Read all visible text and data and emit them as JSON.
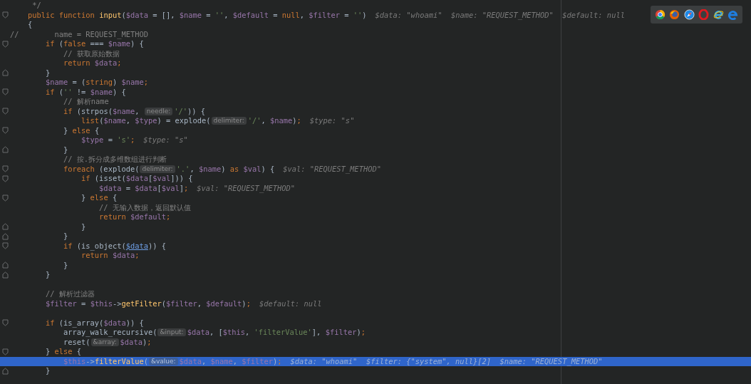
{
  "editor": {
    "lines": [
      {
        "current": false,
        "kind": "plain",
        "tokens": [
          {
            "kind": "comment",
            "text": "     */"
          }
        ]
      },
      {
        "current": false,
        "kind": "opener",
        "tokens": [
          {
            "kind": "kw",
            "text": "    public function "
          },
          {
            "kind": "fn",
            "text": "input"
          },
          {
            "kind": "plain",
            "text": "("
          },
          {
            "kind": "var",
            "text": "$data"
          },
          {
            "kind": "plain",
            "text": " = [], "
          },
          {
            "kind": "var",
            "text": "$name"
          },
          {
            "kind": "plain",
            "text": " = "
          },
          {
            "kind": "str",
            "text": "''"
          },
          {
            "kind": "plain",
            "text": ", "
          },
          {
            "kind": "var",
            "text": "$default"
          },
          {
            "kind": "plain",
            "text": " = "
          },
          {
            "kind": "kw",
            "text": "null"
          },
          {
            "kind": "plain",
            "text": ", "
          },
          {
            "kind": "var",
            "text": "$filter"
          },
          {
            "kind": "plain",
            "text": " = "
          },
          {
            "kind": "str",
            "text": "''"
          },
          {
            "kind": "plain",
            "text": ")"
          },
          {
            "kind": "value",
            "text": "$data: \"whoami\"  $name: \"REQUEST_METHOD\"  $default: null"
          }
        ]
      },
      {
        "current": false,
        "kind": "plain",
        "tokens": [
          {
            "kind": "plain",
            "text": "    {"
          }
        ]
      },
      {
        "current": false,
        "kind": "plain",
        "tokens": [
          {
            "kind": "comment",
            "text": "//        name = REQUEST_METHOD"
          }
        ]
      },
      {
        "current": false,
        "kind": "opener",
        "tokens": [
          {
            "kind": "kw",
            "text": "        if"
          },
          {
            "kind": "plain",
            "text": " ("
          },
          {
            "kind": "kw",
            "text": "false"
          },
          {
            "kind": "plain",
            "text": " === "
          },
          {
            "kind": "var",
            "text": "$name"
          },
          {
            "kind": "plain",
            "text": ") {"
          }
        ]
      },
      {
        "current": false,
        "kind": "plain",
        "tokens": [
          {
            "kind": "comment",
            "text": "            // 获取原始数据"
          }
        ]
      },
      {
        "current": false,
        "kind": "plain",
        "tokens": [
          {
            "kind": "kw",
            "text": "            return "
          },
          {
            "kind": "var",
            "text": "$data"
          },
          {
            "kind": "kw",
            "text": ";"
          }
        ]
      },
      {
        "current": false,
        "kind": "closer",
        "tokens": [
          {
            "kind": "plain",
            "text": "        }"
          }
        ]
      },
      {
        "current": false,
        "kind": "plain",
        "tokens": [
          {
            "kind": "var",
            "text": "        $name"
          },
          {
            "kind": "plain",
            "text": " = ("
          },
          {
            "kind": "kw",
            "text": "string"
          },
          {
            "kind": "plain",
            "text": ") "
          },
          {
            "kind": "var",
            "text": "$name"
          },
          {
            "kind": "kw",
            "text": ";"
          }
        ]
      },
      {
        "current": false,
        "kind": "opener",
        "tokens": [
          {
            "kind": "kw",
            "text": "        if"
          },
          {
            "kind": "plain",
            "text": " ("
          },
          {
            "kind": "str",
            "text": "''"
          },
          {
            "kind": "plain",
            "text": " != "
          },
          {
            "kind": "var",
            "text": "$name"
          },
          {
            "kind": "plain",
            "text": ") {"
          }
        ]
      },
      {
        "current": false,
        "kind": "plain",
        "tokens": [
          {
            "kind": "comment",
            "text": "            // 解析name"
          }
        ]
      },
      {
        "current": false,
        "kind": "opener",
        "tokens": [
          {
            "kind": "kw",
            "text": "            if"
          },
          {
            "kind": "plain",
            "text": " (strpos("
          },
          {
            "kind": "var",
            "text": "$name"
          },
          {
            "kind": "plain",
            "text": ", "
          },
          {
            "kind": "hint",
            "text": "needle:"
          },
          {
            "kind": "str",
            "text": "'/'"
          },
          {
            "kind": "plain",
            "text": ")) {"
          }
        ]
      },
      {
        "current": false,
        "kind": "plain",
        "tokens": [
          {
            "kind": "kw",
            "text": "                list"
          },
          {
            "kind": "plain",
            "text": "("
          },
          {
            "kind": "var",
            "text": "$name"
          },
          {
            "kind": "plain",
            "text": ", "
          },
          {
            "kind": "var",
            "text": "$type"
          },
          {
            "kind": "plain",
            "text": ") = explode("
          },
          {
            "kind": "hint",
            "text": "delimiter:"
          },
          {
            "kind": "str",
            "text": "'/'"
          },
          {
            "kind": "plain",
            "text": ", "
          },
          {
            "kind": "var",
            "text": "$name"
          },
          {
            "kind": "plain",
            "text": ")"
          },
          {
            "kind": "kw",
            "text": ";"
          },
          {
            "kind": "value",
            "text": "$type: \"s\""
          }
        ]
      },
      {
        "current": false,
        "kind": "opener",
        "tokens": [
          {
            "kind": "plain",
            "text": "            } "
          },
          {
            "kind": "kw",
            "text": "else"
          },
          {
            "kind": "plain",
            "text": " {"
          }
        ]
      },
      {
        "current": false,
        "kind": "plain",
        "tokens": [
          {
            "kind": "var",
            "text": "                $type"
          },
          {
            "kind": "plain",
            "text": " = "
          },
          {
            "kind": "str",
            "text": "'s'"
          },
          {
            "kind": "kw",
            "text": ";"
          },
          {
            "kind": "value",
            "text": "$type: \"s\""
          }
        ]
      },
      {
        "current": false,
        "kind": "closer",
        "tokens": [
          {
            "kind": "plain",
            "text": "            }"
          }
        ]
      },
      {
        "current": false,
        "kind": "plain",
        "tokens": [
          {
            "kind": "comment",
            "text": "            // 按.拆分成多维数组进行判断"
          }
        ]
      },
      {
        "current": false,
        "kind": "opener",
        "tokens": [
          {
            "kind": "kw",
            "text": "            foreach"
          },
          {
            "kind": "plain",
            "text": " (explode("
          },
          {
            "kind": "hint",
            "text": "delimiter:"
          },
          {
            "kind": "str",
            "text": "'.'"
          },
          {
            "kind": "plain",
            "text": ", "
          },
          {
            "kind": "var",
            "text": "$name"
          },
          {
            "kind": "plain",
            "text": ") "
          },
          {
            "kind": "kw",
            "text": "as "
          },
          {
            "kind": "var",
            "text": "$val"
          },
          {
            "kind": "plain",
            "text": ") {"
          },
          {
            "kind": "value",
            "text": "$val: \"REQUEST_METHOD\""
          }
        ]
      },
      {
        "current": false,
        "kind": "opener",
        "tokens": [
          {
            "kind": "kw",
            "text": "                if"
          },
          {
            "kind": "plain",
            "text": " (isset("
          },
          {
            "kind": "var",
            "text": "$data"
          },
          {
            "kind": "plain",
            "text": "["
          },
          {
            "kind": "var",
            "text": "$val"
          },
          {
            "kind": "plain",
            "text": "])) {"
          }
        ]
      },
      {
        "current": false,
        "kind": "plain",
        "tokens": [
          {
            "kind": "var",
            "text": "                    $data"
          },
          {
            "kind": "plain",
            "text": " = "
          },
          {
            "kind": "var",
            "text": "$data"
          },
          {
            "kind": "plain",
            "text": "["
          },
          {
            "kind": "var",
            "text": "$val"
          },
          {
            "kind": "plain",
            "text": "]"
          },
          {
            "kind": "kw",
            "text": ";"
          },
          {
            "kind": "value",
            "text": "$val: \"REQUEST_METHOD\""
          }
        ]
      },
      {
        "current": false,
        "kind": "opener",
        "tokens": [
          {
            "kind": "plain",
            "text": "                } "
          },
          {
            "kind": "kw",
            "text": "else"
          },
          {
            "kind": "plain",
            "text": " {"
          }
        ]
      },
      {
        "current": false,
        "kind": "plain",
        "tokens": [
          {
            "kind": "comment",
            "text": "                    // 无输入数据，返回默认值"
          }
        ]
      },
      {
        "current": false,
        "kind": "plain",
        "tokens": [
          {
            "kind": "kw",
            "text": "                    return "
          },
          {
            "kind": "var",
            "text": "$default"
          },
          {
            "kind": "kw",
            "text": ";"
          }
        ]
      },
      {
        "current": false,
        "kind": "closer",
        "tokens": [
          {
            "kind": "plain",
            "text": "                }"
          }
        ]
      },
      {
        "current": false,
        "kind": "closer",
        "tokens": [
          {
            "kind": "plain",
            "text": "            }"
          }
        ]
      },
      {
        "current": false,
        "kind": "opener",
        "tokens": [
          {
            "kind": "kw",
            "text": "            if"
          },
          {
            "kind": "plain",
            "text": " (is_object("
          },
          {
            "kind": "link",
            "text": "$data"
          },
          {
            "kind": "plain",
            "text": ")) {"
          }
        ]
      },
      {
        "current": false,
        "kind": "plain",
        "tokens": [
          {
            "kind": "kw",
            "text": "                return "
          },
          {
            "kind": "var",
            "text": "$data"
          },
          {
            "kind": "kw",
            "text": ";"
          }
        ]
      },
      {
        "current": false,
        "kind": "closer",
        "tokens": [
          {
            "kind": "plain",
            "text": "            }"
          }
        ]
      },
      {
        "current": false,
        "kind": "closer",
        "tokens": [
          {
            "kind": "plain",
            "text": "        }"
          }
        ]
      },
      {
        "current": false,
        "kind": "plain"
      },
      {
        "current": false,
        "kind": "plain",
        "tokens": [
          {
            "kind": "comment",
            "text": "        // 解析过滤器"
          }
        ]
      },
      {
        "current": false,
        "kind": "plain",
        "tokens": [
          {
            "kind": "var",
            "text": "        $filter"
          },
          {
            "kind": "plain",
            "text": " = "
          },
          {
            "kind": "var",
            "text": "$this"
          },
          {
            "kind": "plain",
            "text": "->"
          },
          {
            "kind": "fn",
            "text": "getFilter"
          },
          {
            "kind": "plain",
            "text": "("
          },
          {
            "kind": "var",
            "text": "$filter"
          },
          {
            "kind": "plain",
            "text": ", "
          },
          {
            "kind": "var",
            "text": "$default"
          },
          {
            "kind": "plain",
            "text": ")"
          },
          {
            "kind": "kw",
            "text": ";"
          },
          {
            "kind": "value",
            "text": "$default: null"
          }
        ]
      },
      {
        "current": false,
        "kind": "plain"
      },
      {
        "current": false,
        "kind": "opener",
        "tokens": [
          {
            "kind": "kw",
            "text": "        if"
          },
          {
            "kind": "plain",
            "text": " (is_array("
          },
          {
            "kind": "var",
            "text": "$data"
          },
          {
            "kind": "plain",
            "text": ")) {"
          }
        ]
      },
      {
        "current": false,
        "kind": "plain",
        "tokens": [
          {
            "kind": "plain",
            "text": "            array_walk_recursive("
          },
          {
            "kind": "hint",
            "text": "&input:"
          },
          {
            "kind": "var",
            "text": "$data"
          },
          {
            "kind": "plain",
            "text": ", ["
          },
          {
            "kind": "var",
            "text": "$this"
          },
          {
            "kind": "plain",
            "text": ", "
          },
          {
            "kind": "str",
            "text": "'filterValue'"
          },
          {
            "kind": "plain",
            "text": "], "
          },
          {
            "kind": "var",
            "text": "$filter"
          },
          {
            "kind": "plain",
            "text": ")"
          },
          {
            "kind": "kw",
            "text": ";"
          }
        ]
      },
      {
        "current": false,
        "kind": "plain",
        "tokens": [
          {
            "kind": "plain",
            "text": "            reset("
          },
          {
            "kind": "hint",
            "text": "&array:"
          },
          {
            "kind": "var",
            "text": "$data"
          },
          {
            "kind": "plain",
            "text": ")"
          },
          {
            "kind": "kw",
            "text": ";"
          }
        ]
      },
      {
        "current": false,
        "kind": "opener",
        "tokens": [
          {
            "kind": "plain",
            "text": "        } "
          },
          {
            "kind": "kw",
            "text": "else"
          },
          {
            "kind": "plain",
            "text": " {"
          }
        ]
      },
      {
        "current": true,
        "kind": "plain",
        "tokens": [
          {
            "kind": "var",
            "text": "            $this"
          },
          {
            "kind": "plain",
            "text": "->"
          },
          {
            "kind": "fn",
            "text": "filterValue"
          },
          {
            "kind": "plain",
            "text": "("
          },
          {
            "kind": "hint",
            "text": "&value:"
          },
          {
            "kind": "var",
            "text": "$data"
          },
          {
            "kind": "plain",
            "text": ", "
          },
          {
            "kind": "var",
            "text": "$name"
          },
          {
            "kind": "plain",
            "text": ", "
          },
          {
            "kind": "var",
            "text": "$filter"
          },
          {
            "kind": "plain",
            "text": ")"
          },
          {
            "kind": "kw",
            "text": ";"
          },
          {
            "kind": "value",
            "text": "$data: \"whoami\"  $filter: {\"system\", null}[2]  $name: \"REQUEST_METHOD\""
          }
        ]
      },
      {
        "current": false,
        "kind": "closer",
        "tokens": [
          {
            "kind": "plain",
            "text": "        }"
          }
        ]
      }
    ]
  }
}
